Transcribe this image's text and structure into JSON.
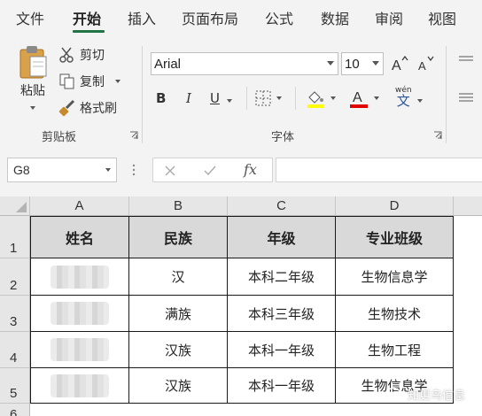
{
  "tabs": [
    "文件",
    "开始",
    "插入",
    "页面布局",
    "公式",
    "数据",
    "审阅",
    "视图"
  ],
  "active_tab": "开始",
  "clipboard": {
    "paste_label": "粘贴",
    "cut_label": "剪切",
    "copy_label": "复制",
    "format_painter_label": "格式刷",
    "group_label": "剪贴板"
  },
  "font": {
    "font_name": "Arial",
    "font_size": "10",
    "bold_label": "B",
    "italic_label": "I",
    "underline_label": "U",
    "phonetic_label": "wén",
    "phonetic_char": "文",
    "group_label": "字体",
    "font_color": "#e00000"
  },
  "formula_bar": {
    "cell_ref": "G8",
    "fx_label": "fx",
    "formula": ""
  },
  "sheet": {
    "columns": [
      "A",
      "B",
      "C",
      "D"
    ],
    "rows": [
      "1",
      "2",
      "3",
      "4",
      "5",
      "6"
    ],
    "header": [
      "姓名",
      "民族",
      "年级",
      "专业班级"
    ],
    "data": [
      [
        "",
        "汉",
        "本科二年级",
        "生物信息学"
      ],
      [
        "",
        "满族",
        "本科三年级",
        "生物技术"
      ],
      [
        "",
        "汉族",
        "本科一年级",
        "生物工程"
      ],
      [
        "",
        "汉族",
        "本科一年级",
        "生物信息学"
      ]
    ]
  },
  "watermarks": [
    "知更鸟信息"
  ],
  "colors": {
    "accent": "#217346",
    "header_fill": "#d9d9d9"
  }
}
